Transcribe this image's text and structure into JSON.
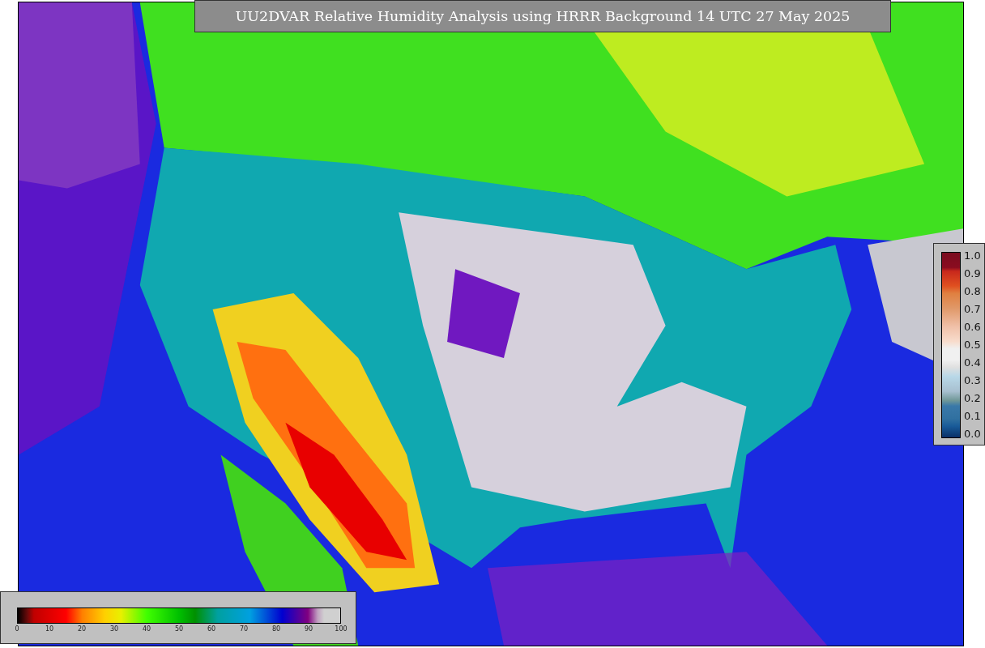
{
  "title": "UU2DVAR Relative Humidity Analysis using HRRR Background 14 UTC 27 May 2025",
  "humidity_legend": {
    "tick_labels": [
      "0",
      "10",
      "20",
      "30",
      "40",
      "50",
      "60",
      "70",
      "80",
      "90",
      "100"
    ]
  },
  "ratio_legend": {
    "tick_labels": [
      "1.0",
      "0.9",
      "0.8",
      "0.7",
      "0.6",
      "0.5",
      "0.4",
      "0.3",
      "0.2",
      "0.1",
      "0.0"
    ]
  }
}
